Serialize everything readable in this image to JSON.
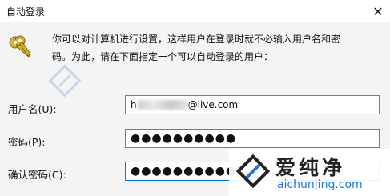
{
  "window": {
    "title": "自动登录",
    "close_glyph": "✕"
  },
  "description": {
    "line1": "你可以对计算机进行设置，这样用户在登录时就不必输入用户名和密",
    "line2": "码。为此，请在下面指定一个可以自动登录的用户："
  },
  "form": {
    "username_label": "用户名(U):",
    "username_prefix": "h",
    "username_suffix": "@live.com",
    "password_label": "密码(P):",
    "password_value": "●●●●●●●●●●",
    "confirm_label": "确认密码(C):",
    "confirm_value": "●●●●●●●●●●"
  },
  "watermark": {
    "name": "爱纯净",
    "url": "aichunjing.com"
  },
  "colors": {
    "focus_border": "#0078d7",
    "watermark_url": "#1f7ad6",
    "key_icon": "#c9a227"
  }
}
